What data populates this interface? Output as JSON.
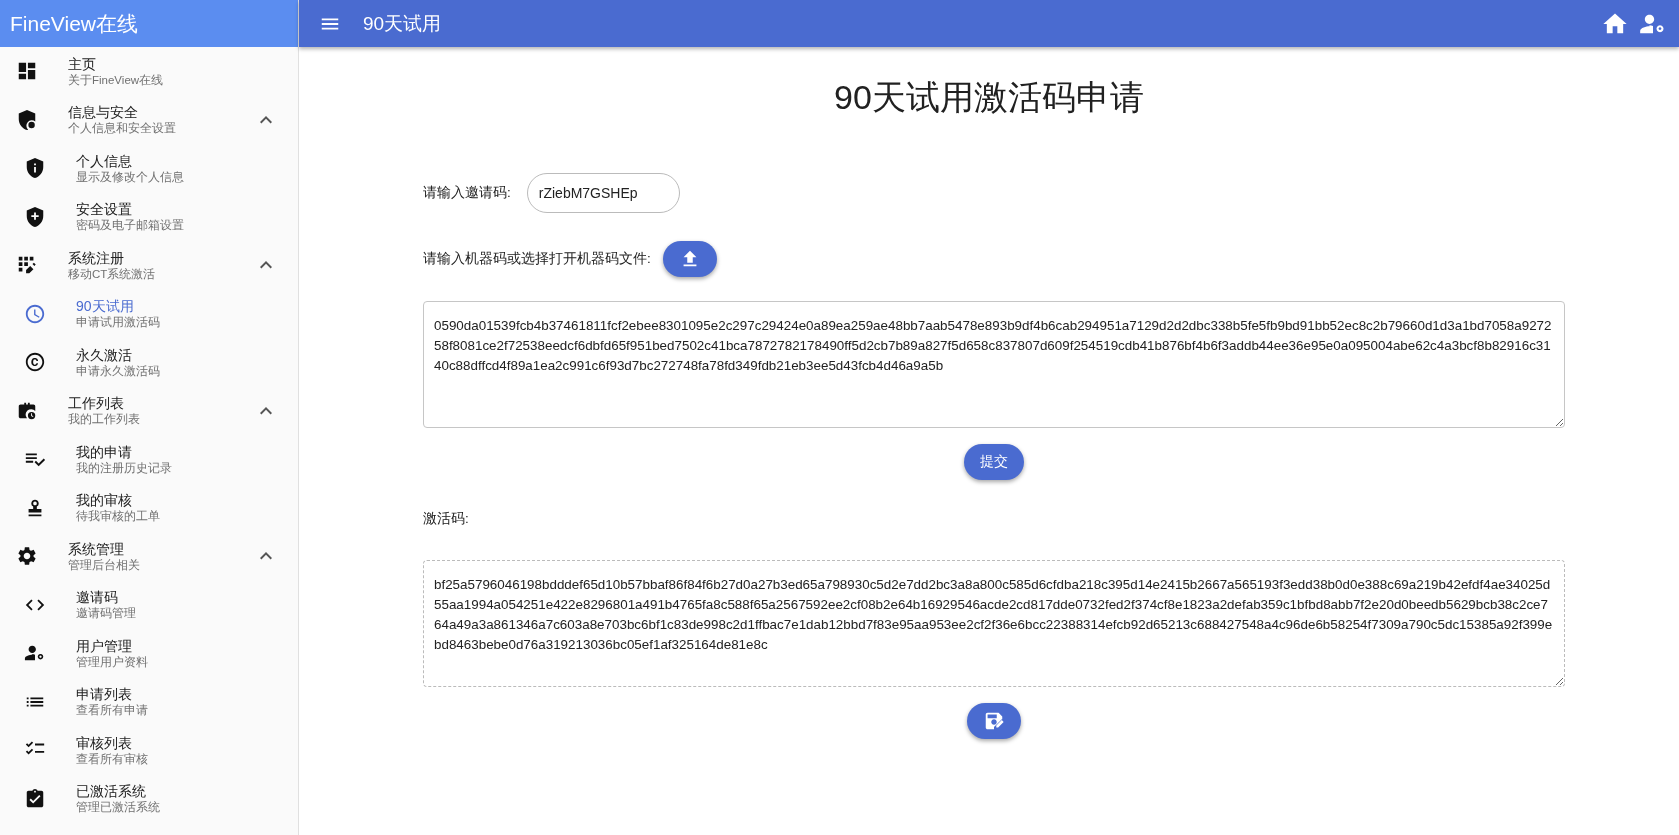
{
  "app_title": "FineView在线",
  "header": {
    "title": "90天试用"
  },
  "nav": [
    {
      "label": "主页",
      "sub": "关于FineView在线",
      "selected": false
    },
    {
      "label": "信息与安全",
      "sub": "个人信息和安全设置",
      "selected": false,
      "expanded": true,
      "children": [
        {
          "label": "个人信息",
          "sub": "显示及修改个人信息",
          "selected": false
        },
        {
          "label": "安全设置",
          "sub": "密码及电子邮箱设置",
          "selected": false
        }
      ]
    },
    {
      "label": "系统注册",
      "sub": "移动CT系统激活",
      "selected": false,
      "expanded": true,
      "children": [
        {
          "label": "90天试用",
          "sub": "申请试用激活码",
          "selected": true
        },
        {
          "label": "永久激活",
          "sub": "申请永久激活码",
          "selected": false
        }
      ]
    },
    {
      "label": "工作列表",
      "sub": "我的工作列表",
      "selected": false,
      "expanded": true,
      "children": [
        {
          "label": "我的申请",
          "sub": "我的注册历史记录",
          "selected": false
        },
        {
          "label": "我的审核",
          "sub": "待我审核的工单",
          "selected": false
        }
      ]
    },
    {
      "label": "系统管理",
      "sub": "管理后台相关",
      "selected": false,
      "expanded": true,
      "children": [
        {
          "label": "邀请码",
          "sub": "邀请码管理",
          "selected": false
        },
        {
          "label": "用户管理",
          "sub": "管理用户资料",
          "selected": false
        },
        {
          "label": "申请列表",
          "sub": "查看所有申请",
          "selected": false
        },
        {
          "label": "审核列表",
          "sub": "查看所有审核",
          "selected": false
        },
        {
          "label": "已激活系统",
          "sub": "管理已激活系统",
          "selected": false
        }
      ]
    }
  ],
  "page": {
    "title": "90天试用激活码申请",
    "invite": {
      "label": "请输入邀请码:",
      "value": "rZiebM7GSHEp"
    },
    "machine": {
      "label": "请输入机器码或选择打开机器码文件:",
      "value": "0590da01539fcb4b37461811fcf2ebee8301095e2c297c29424e0a89ea259ae48bb7aab5478e893b9df4b6cab294951a7129d2d2dbc338b5fe5fb9bd91bb52ec8c2b79660d1d3a1bd7058a927258f8081ce2f72538eedcf6dbfd65f951bed7502c41bca7872782178490ff5d2cb7b89a827f5d658c837807d609f254519cdb41b876bf4b6f3addb44ee36e95e0a095004abe62c4a3bcf8b82916c3140c88dffcd4f89a1ea2c991c6f93d7bc272748fa78fd349fdb21eb3ee5d43fcb4d46a9a5b"
    },
    "submit": "提交",
    "activation": {
      "label": "激活码:",
      "value": "bf25a5796046198bdddef65d10b57bbaf86f84f6b27d0a27b3ed65a798930c5d2e7dd2bc3a8a800c585d6cfdba218c395d14e2415b2667a565193f3edd38b0d0e388c69a219b42efdf4ae34025d55aa1994a054251e422e8296801a491b4765fa8c588f65a2567592ee2cf08b2e64b16929546acde2cd817dde0732fed2f374cf8e1823a2defab359c1bfbd8abb7f2e20d0beedb5629bcb38c2ce764a49a3a861346a7c603a8e703bc6bf1c83de998c2d1ffbac7e1dab12bbd7f83e95aa953ee2cf2f36e6bcc22388314efcb92d65213c688427548a4c96de6b58254f7309a790c5dc15385a92f399ebd8463bebe0d76a319213036bc05ef1af325164de81e8c"
    }
  }
}
